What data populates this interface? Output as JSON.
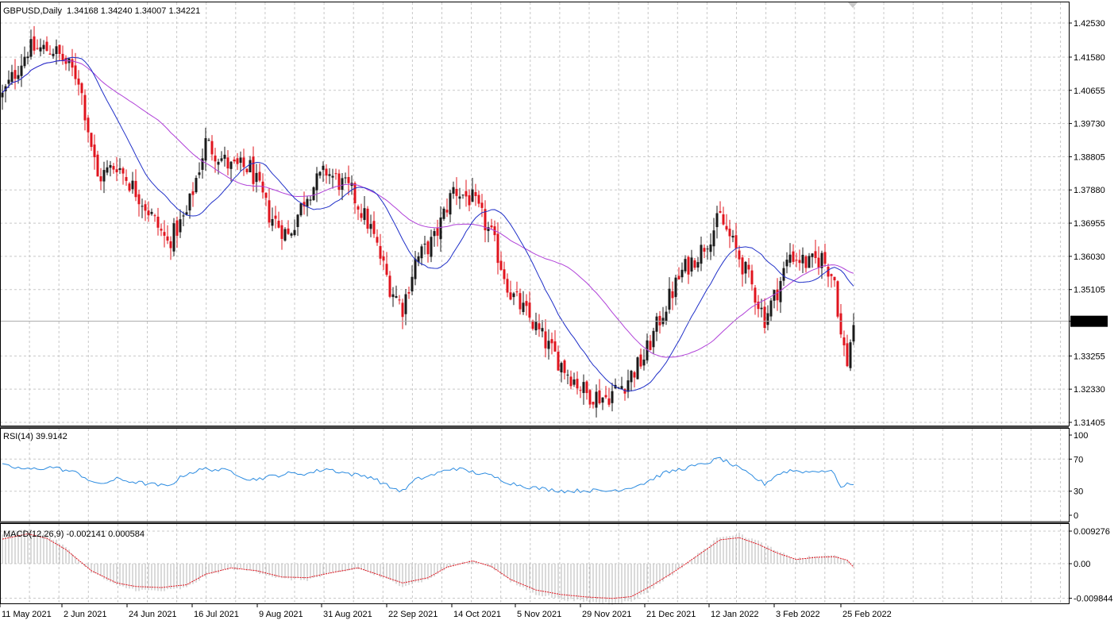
{
  "symbol": "GBPUSD",
  "timeframe": "Daily",
  "ohlc_header": "1.34168 1.34240 1.34007 1.34221",
  "price_axis_labels": [
    "1.42530",
    "1.41580",
    "1.40655",
    "1.39730",
    "1.38805",
    "1.37880",
    "1.36955",
    "1.36030",
    "1.35105",
    "1.34221",
    "1.33255",
    "1.32330",
    "1.31405"
  ],
  "current_price_label": "1.34221",
  "date_labels": [
    "11 May 2021",
    "2 Jun 2021",
    "24 Jun 2021",
    "16 Jul 2021",
    "9 Aug 2021",
    "31 Aug 2021",
    "22 Sep 2021",
    "14 Oct 2021",
    "5 Nov 2021",
    "29 Nov 2021",
    "21 Dec 2021",
    "12 Jan 2022",
    "3 Feb 2022",
    "25 Feb 2022"
  ],
  "rsi_header": "RSI(14) 39.9142",
  "rsi_axis_labels": [
    "100",
    "70",
    "30",
    "0"
  ],
  "macd_header": "MACD(12,26,9) -0.002141 0.000584",
  "macd_axis_labels": [
    "0.009276",
    "0.00",
    "-0.009844"
  ],
  "colors": {
    "bull": "#1a1a1a",
    "bear": "#e0141e",
    "ma_fast": "#1f2fc8",
    "ma_slow": "#b040d8",
    "rsi": "#2b8be0",
    "macd_signal": "#e0141e",
    "macd_hist": "#b4b4b4",
    "grid": "#c8c8c8",
    "price_line": "#a8a8a8"
  },
  "chart_data": {
    "type": "candlestick",
    "indicators": [
      "MA fast",
      "MA slow",
      "RSI(14)",
      "MACD(12,26,9)"
    ],
    "ylim": [
      1.31405,
      1.4253
    ],
    "rsi_ylim": [
      0,
      100
    ],
    "macd_ylim": [
      -0.009844,
      0.009276
    ],
    "last_close": 1.34221,
    "anchors": [
      [
        0,
        1.405
      ],
      [
        8,
        1.418
      ],
      [
        16,
        1.418
      ],
      [
        24,
        1.41
      ],
      [
        30,
        1.382
      ],
      [
        36,
        1.386
      ],
      [
        44,
        1.376
      ],
      [
        52,
        1.364
      ],
      [
        58,
        1.372
      ],
      [
        64,
        1.392
      ],
      [
        72,
        1.385
      ],
      [
        78,
        1.385
      ],
      [
        84,
        1.372
      ],
      [
        90,
        1.366
      ],
      [
        96,
        1.378
      ],
      [
        102,
        1.384
      ],
      [
        110,
        1.378
      ],
      [
        116,
        1.368
      ],
      [
        122,
        1.352
      ],
      [
        126,
        1.346
      ],
      [
        130,
        1.359
      ],
      [
        136,
        1.365
      ],
      [
        142,
        1.379
      ],
      [
        148,
        1.376
      ],
      [
        154,
        1.366
      ],
      [
        160,
        1.35
      ],
      [
        166,
        1.343
      ],
      [
        172,
        1.335
      ],
      [
        178,
        1.328
      ],
      [
        184,
        1.322
      ],
      [
        190,
        1.321
      ],
      [
        196,
        1.325
      ],
      [
        202,
        1.332
      ],
      [
        208,
        1.345
      ],
      [
        214,
        1.356
      ],
      [
        220,
        1.362
      ],
      [
        226,
        1.371
      ],
      [
        232,
        1.36
      ],
      [
        236,
        1.352
      ],
      [
        240,
        1.343
      ],
      [
        244,
        1.351
      ],
      [
        248,
        1.361
      ],
      [
        254,
        1.358
      ],
      [
        258,
        1.36
      ],
      [
        262,
        1.354
      ],
      [
        264,
        1.338
      ],
      [
        266,
        1.331
      ],
      [
        268,
        1.342
      ]
    ],
    "rsi_anchors": [
      [
        0,
        62
      ],
      [
        8,
        57
      ],
      [
        16,
        60
      ],
      [
        24,
        52
      ],
      [
        30,
        38
      ],
      [
        36,
        45
      ],
      [
        44,
        40
      ],
      [
        52,
        36
      ],
      [
        58,
        52
      ],
      [
        64,
        58
      ],
      [
        72,
        55
      ],
      [
        78,
        44
      ],
      [
        84,
        48
      ],
      [
        90,
        52
      ],
      [
        96,
        52
      ],
      [
        102,
        58
      ],
      [
        110,
        51
      ],
      [
        116,
        48
      ],
      [
        122,
        35
      ],
      [
        126,
        30
      ],
      [
        130,
        44
      ],
      [
        136,
        51
      ],
      [
        142,
        59
      ],
      [
        148,
        54
      ],
      [
        154,
        49
      ],
      [
        160,
        40
      ],
      [
        166,
        35
      ],
      [
        172,
        32
      ],
      [
        178,
        30
      ],
      [
        184,
        31
      ],
      [
        190,
        30
      ],
      [
        196,
        33
      ],
      [
        202,
        40
      ],
      [
        208,
        52
      ],
      [
        214,
        58
      ],
      [
        220,
        63
      ],
      [
        226,
        71
      ],
      [
        232,
        58
      ],
      [
        236,
        49
      ],
      [
        240,
        39
      ],
      [
        244,
        51
      ],
      [
        248,
        56
      ],
      [
        254,
        54
      ],
      [
        258,
        56
      ],
      [
        262,
        53
      ],
      [
        264,
        34
      ],
      [
        266,
        38
      ],
      [
        268,
        40
      ]
    ],
    "macd_anchors": [
      [
        0,
        0.007
      ],
      [
        8,
        0.0085
      ],
      [
        14,
        0.0072
      ],
      [
        20,
        0.004
      ],
      [
        28,
        -0.002
      ],
      [
        36,
        -0.0055
      ],
      [
        42,
        -0.0065
      ],
      [
        50,
        -0.0068
      ],
      [
        58,
        -0.006
      ],
      [
        64,
        -0.003
      ],
      [
        72,
        -0.0012
      ],
      [
        80,
        -0.002
      ],
      [
        88,
        -0.0038
      ],
      [
        96,
        -0.004
      ],
      [
        104,
        -0.0025
      ],
      [
        112,
        -0.0012
      ],
      [
        118,
        -0.003
      ],
      [
        126,
        -0.0055
      ],
      [
        134,
        -0.004
      ],
      [
        140,
        -0.001
      ],
      [
        148,
        0.0008
      ],
      [
        154,
        -0.0008
      ],
      [
        160,
        -0.0045
      ],
      [
        168,
        -0.0075
      ],
      [
        176,
        -0.0088
      ],
      [
        184,
        -0.0095
      ],
      [
        192,
        -0.0099
      ],
      [
        198,
        -0.0094
      ],
      [
        204,
        -0.0065
      ],
      [
        212,
        -0.002
      ],
      [
        220,
        0.003
      ],
      [
        226,
        0.0068
      ],
      [
        232,
        0.0074
      ],
      [
        238,
        0.0055
      ],
      [
        244,
        0.003
      ],
      [
        250,
        0.0012
      ],
      [
        256,
        0.0018
      ],
      [
        262,
        0.002
      ],
      [
        266,
        0.001
      ],
      [
        268,
        -0.001
      ]
    ]
  }
}
